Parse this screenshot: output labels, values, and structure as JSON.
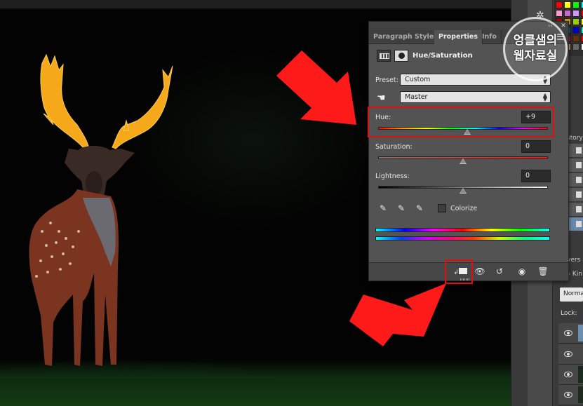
{
  "panel": {
    "tabs": [
      {
        "label": "Paragraph Styles",
        "active": false
      },
      {
        "label": "Properties",
        "active": true
      },
      {
        "label": "Info",
        "active": false
      }
    ],
    "adjustment_title": "Hue/Saturation",
    "preset_label": "Preset:",
    "preset_value": "Custom",
    "channel_value": "Master",
    "hue": {
      "label": "Hue:",
      "value": "+9",
      "slider_value": 9,
      "min": -180,
      "max": 180
    },
    "saturation": {
      "label": "Saturation:",
      "value": "0",
      "slider_value": 0,
      "min": -100,
      "max": 100
    },
    "lightness": {
      "label": "Lightness:",
      "value": "0",
      "slider_value": 0,
      "min": -100,
      "max": 100
    },
    "colorize_label": "Colorize",
    "colorize_checked": false,
    "footer_buttons": [
      "clip-to-layer-icon",
      "eye-preview-icon",
      "reset-icon",
      "visibility-icon",
      "trash-icon"
    ]
  },
  "dock": {
    "history_title": "story",
    "layers_title": "yers",
    "layers_kind": "Kin",
    "blend_mode": "Norma",
    "lock_label": "Lock:"
  },
  "watermark": {
    "line1": "엉클샘의",
    "line2": "웹자료실"
  },
  "colors": {
    "highlight": "#e01010",
    "arrow": "#ff1a1a",
    "panel_bg": "#535353"
  }
}
